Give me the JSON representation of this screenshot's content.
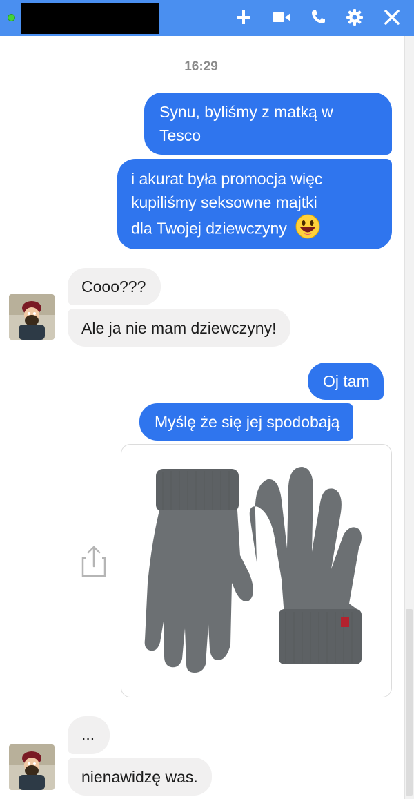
{
  "header": {
    "icons": [
      "plus-icon",
      "video-camera-icon",
      "phone-icon",
      "gear-icon",
      "close-icon"
    ],
    "color": "#4a8ff0"
  },
  "conversation": {
    "timestamp": "16:29",
    "messages": [
      {
        "direction": "out",
        "lines": [
          "Synu, byliśmy z matką w",
          "Tesco"
        ]
      },
      {
        "direction": "out",
        "lines": [
          "i akurat była promocja więc",
          "kupiliśmy seksowne majtki",
          "dla Twojej dziewczyny"
        ],
        "emoji": "smiling-face-emoji"
      },
      {
        "direction": "in",
        "text": "Cooo???"
      },
      {
        "direction": "in",
        "text": "Ale ja nie mam dziewczyny!"
      },
      {
        "direction": "out",
        "text": "Oj tam"
      },
      {
        "direction": "out",
        "text": "Myślę że się jej spodobają"
      },
      {
        "direction": "out",
        "attachment": "grey-knitted-gloves-image"
      },
      {
        "direction": "in",
        "text": "..."
      },
      {
        "direction": "in",
        "text": "nienawidzę was."
      }
    ]
  },
  "colors": {
    "outgoing_bubble": "#2f75ee",
    "incoming_bubble": "#f1f0f0",
    "online_dot": "#43d33a"
  }
}
